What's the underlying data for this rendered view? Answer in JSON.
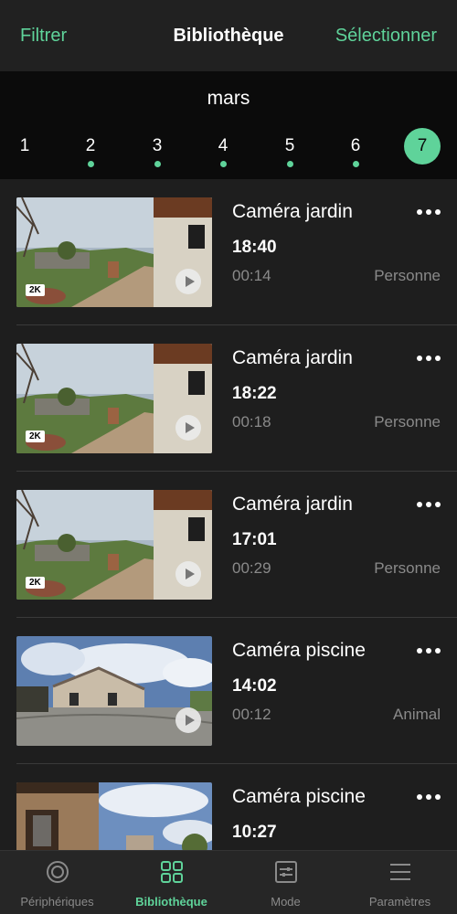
{
  "header": {
    "filter_label": "Filtrer",
    "title": "Bibliothèque",
    "select_label": "Sélectionner"
  },
  "date_strip": {
    "month": "mars",
    "days": [
      {
        "label": "1",
        "has_events": false,
        "selected": false
      },
      {
        "label": "2",
        "has_events": true,
        "selected": false
      },
      {
        "label": "3",
        "has_events": true,
        "selected": false
      },
      {
        "label": "4",
        "has_events": true,
        "selected": false
      },
      {
        "label": "5",
        "has_events": true,
        "selected": false
      },
      {
        "label": "6",
        "has_events": true,
        "selected": false
      },
      {
        "label": "7",
        "has_events": false,
        "selected": true
      }
    ]
  },
  "recordings": [
    {
      "camera": "Caméra jardin",
      "time": "18:40",
      "duration": "00:14",
      "tag": "Personne",
      "quality": "2K",
      "scene": "garden"
    },
    {
      "camera": "Caméra jardin",
      "time": "18:22",
      "duration": "00:18",
      "tag": "Personne",
      "quality": "2K",
      "scene": "garden"
    },
    {
      "camera": "Caméra jardin",
      "time": "17:01",
      "duration": "00:29",
      "tag": "Personne",
      "quality": "2K",
      "scene": "garden"
    },
    {
      "camera": "Caméra piscine",
      "time": "14:02",
      "duration": "00:12",
      "tag": "Animal",
      "quality": "",
      "scene": "pool"
    },
    {
      "camera": "Caméra piscine",
      "time": "10:27",
      "duration": "",
      "tag": "",
      "quality": "",
      "scene": "pool2"
    }
  ],
  "tabbar": {
    "tabs": [
      {
        "label": "Périphériques",
        "icon": "devices-icon",
        "active": false
      },
      {
        "label": "Bibliothèque",
        "icon": "grid-icon",
        "active": true
      },
      {
        "label": "Mode",
        "icon": "sliders-icon",
        "active": false
      },
      {
        "label": "Paramètres",
        "icon": "menu-icon",
        "active": false
      }
    ]
  },
  "colors": {
    "accent": "#5fd39a",
    "background": "#1e1e1e",
    "strip_background": "#0b0b0b",
    "secondary_text": "#8a8a8a"
  }
}
